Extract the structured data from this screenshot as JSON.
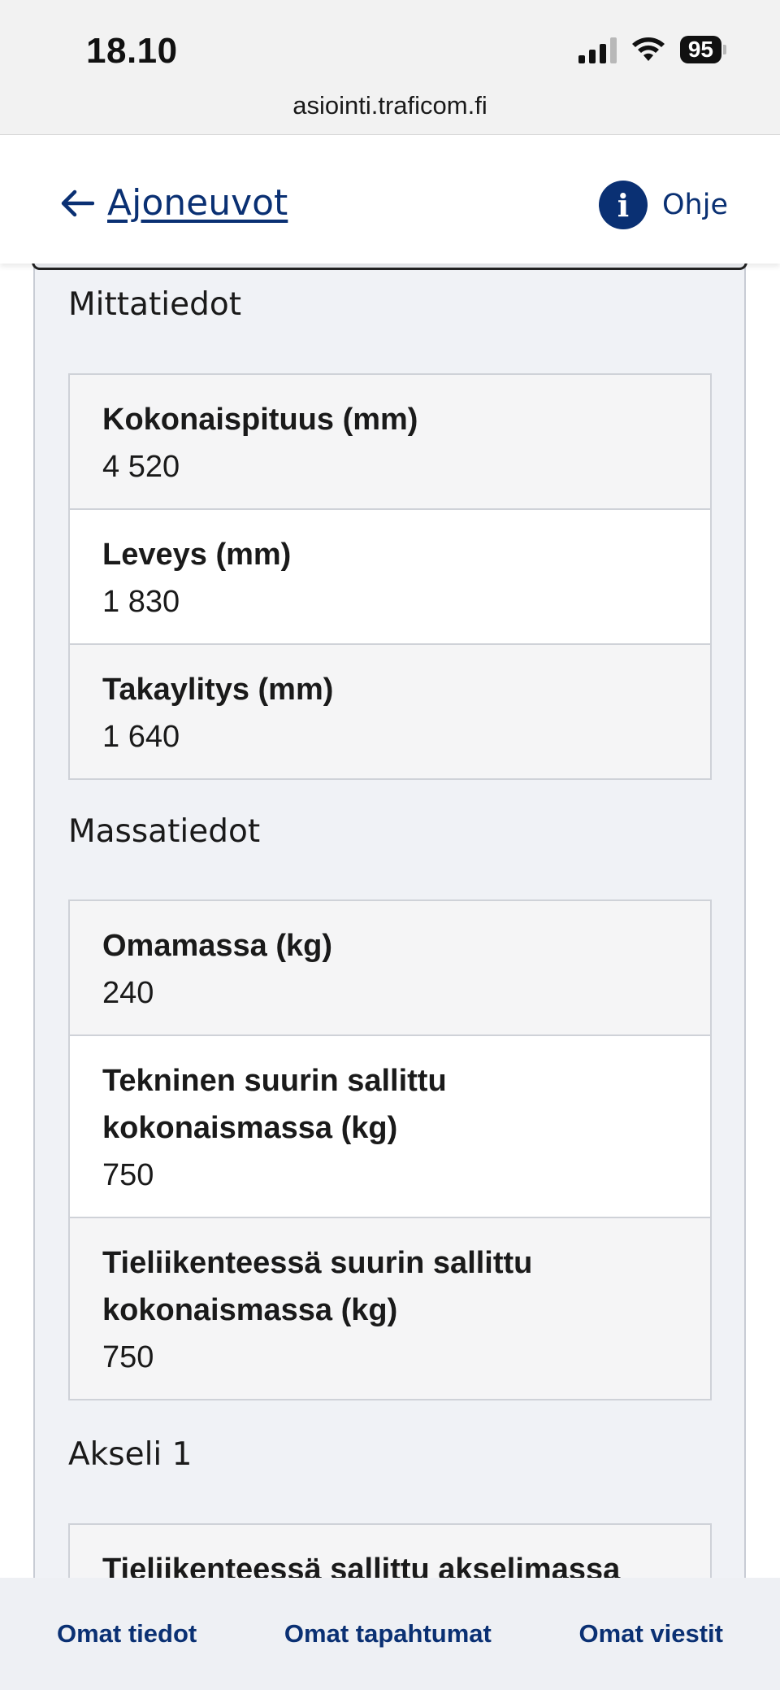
{
  "status_bar": {
    "time": "18.10",
    "battery": "95"
  },
  "browser": {
    "url": "asiointi.traficom.fi"
  },
  "header": {
    "back_label": "Ajoneuvot",
    "help_label": "Ohje"
  },
  "sections": {
    "dimensions": {
      "title": "Mittatiedot",
      "rows": [
        {
          "label": "Kokonaispituus (mm)",
          "value": "4 520"
        },
        {
          "label": "Leveys (mm)",
          "value": "1 830"
        },
        {
          "label": "Takaylitys (mm)",
          "value": "1 640"
        }
      ]
    },
    "masses": {
      "title": "Massatiedot",
      "rows": [
        {
          "label": "Omamassa (kg)",
          "value": "240"
        },
        {
          "label_line1": "Tekninen suurin sallittu",
          "label_line2": "kokonaismassa (kg)",
          "value": "750"
        },
        {
          "label_line1": "Tieliikenteessä suurin sallittu",
          "label_line2": "kokonaismassa (kg)",
          "value": "750"
        }
      ]
    },
    "axle1": {
      "title": "Akseli 1",
      "rows": [
        {
          "label": "Tieliikenteessä sallittu akselimassa"
        }
      ]
    }
  },
  "bottom_nav": {
    "items": [
      "Omat tiedot",
      "Omat tapahtumat",
      "Omat viestit"
    ]
  },
  "colors": {
    "brand": "#0a3073",
    "card_bg": "#f0f2f6"
  }
}
